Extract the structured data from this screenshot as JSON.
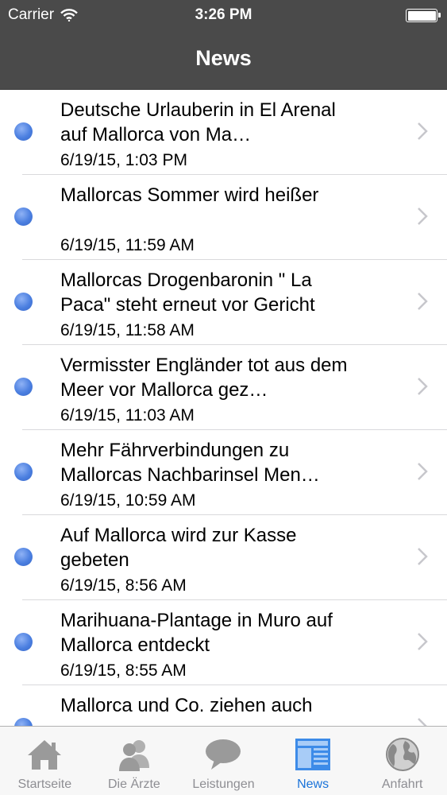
{
  "status_bar": {
    "carrier": "Carrier",
    "time": "3:26 PM"
  },
  "nav": {
    "title": "News"
  },
  "news": [
    {
      "headline": "Deutsche Urlauberin in El Arenal auf Mallorca von Ma…",
      "date": "6/19/15, 1:03 PM"
    },
    {
      "headline": "Mallorcas Sommer wird heißer",
      "date": "6/19/15, 11:59 AM"
    },
    {
      "headline": "Mallorcas Drogenbaronin \" La Paca\" steht erneut vor Gericht",
      "date": "6/19/15, 11:58 AM"
    },
    {
      "headline": "Vermisster Engländer tot aus dem Meer vor Mallorca gez…",
      "date": "6/19/15, 11:03 AM"
    },
    {
      "headline": "Mehr Fährverbindungen zu Mallorcas Nachbarinsel Men…",
      "date": "6/19/15, 10:59 AM"
    },
    {
      "headline": "Auf Mallorca wird zur Kasse gebeten",
      "date": "6/19/15, 8:56 AM"
    },
    {
      "headline": "Marihuana-Plantage in Muro auf Mallorca entdeckt",
      "date": "6/19/15, 8:55 AM"
    },
    {
      "headline": "Mallorca und Co. ziehen auch",
      "date": ""
    }
  ],
  "tabs": [
    {
      "label": "Startseite",
      "icon": "house-icon"
    },
    {
      "label": "Die Ärzte",
      "icon": "people-icon"
    },
    {
      "label": "Leistungen",
      "icon": "speech-bubble-icon"
    },
    {
      "label": "News",
      "icon": "newspaper-icon",
      "active": true
    },
    {
      "label": "Anfahrt",
      "icon": "globe-icon"
    }
  ],
  "colors": {
    "bar_background": "#4a4a4a",
    "unread_dot": "#4b7fe0",
    "tab_active": "#1a73d9",
    "tab_inactive": "#8e8e93"
  }
}
